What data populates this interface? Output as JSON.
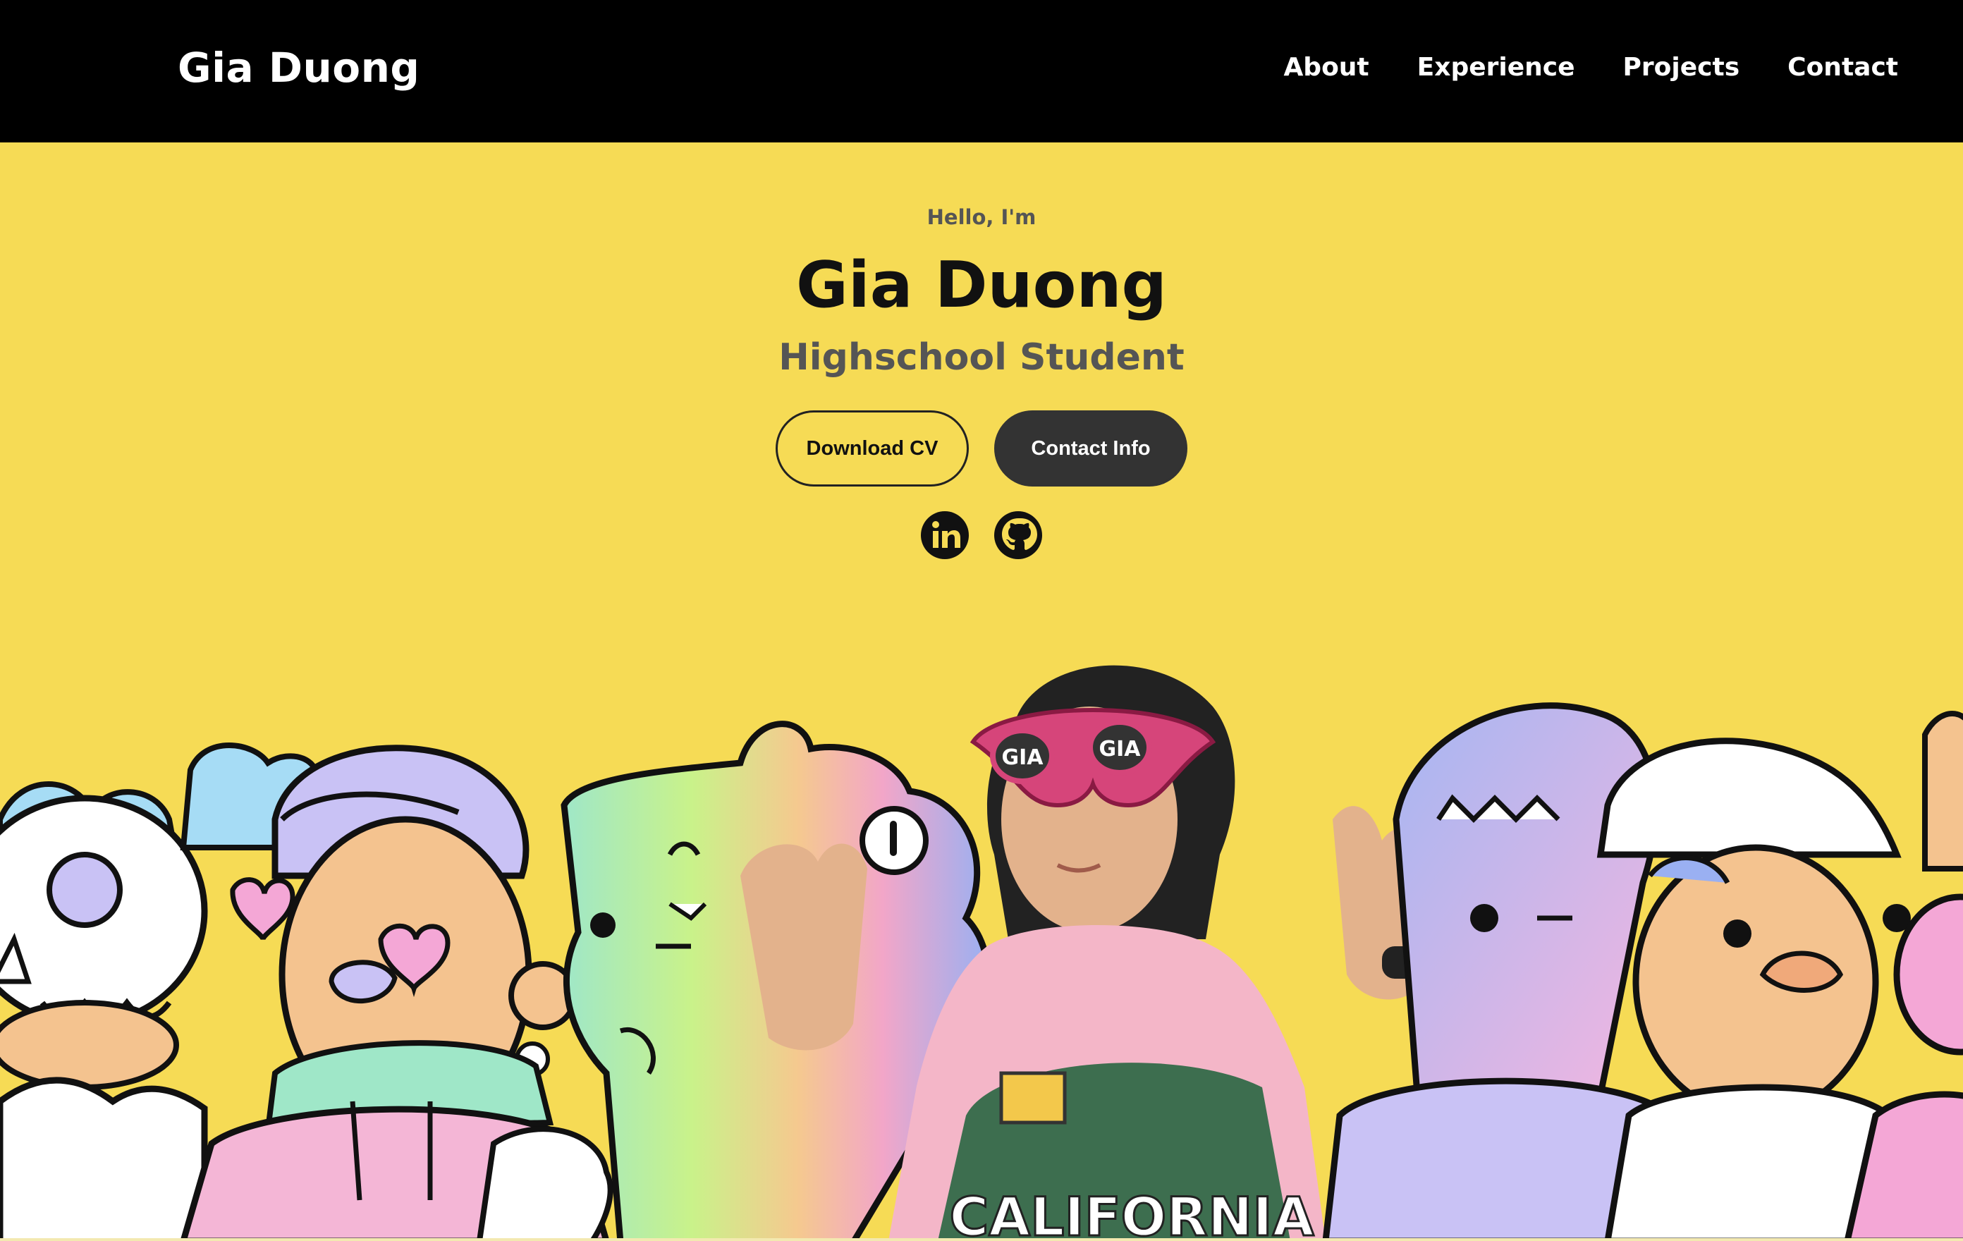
{
  "navbar": {
    "brand": "Gia Duong",
    "links": [
      "About",
      "Experience",
      "Projects",
      "Contact"
    ]
  },
  "hero": {
    "greeting": "Hello, I'm",
    "name": "Gia Duong",
    "role": "Highschool Student",
    "buttons": {
      "download_cv": "Download CV",
      "contact_info": "Contact Info"
    },
    "socials": [
      "linkedin-icon",
      "github-icon"
    ],
    "illustration_text": {
      "shirt": "CALIFORNIA",
      "glasses_left": "GIA",
      "glasses_right": "GIA"
    }
  },
  "colors": {
    "navbar_bg": "#000000",
    "hero_bg": "#f6db55",
    "text_dark": "#111111",
    "text_muted": "#555555",
    "button_dark": "#333333"
  }
}
